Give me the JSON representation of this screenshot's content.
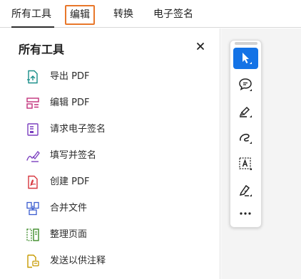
{
  "tabs": [
    {
      "label": "所有工具"
    },
    {
      "label": "编辑"
    },
    {
      "label": "转换"
    },
    {
      "label": "电子签名"
    }
  ],
  "panel": {
    "title": "所有工具",
    "close_icon": "close-icon",
    "tools": [
      {
        "label": "导出 PDF",
        "icon": "export-pdf-icon",
        "color": "#1a8f8a"
      },
      {
        "label": "编辑 PDF",
        "icon": "edit-pdf-icon",
        "color": "#c2307a"
      },
      {
        "label": "请求电子签名",
        "icon": "request-esign-icon",
        "color": "#7b3fbf"
      },
      {
        "label": "填写并签名",
        "icon": "fill-sign-icon",
        "color": "#7b3fbf"
      },
      {
        "label": "创建 PDF",
        "icon": "create-pdf-icon",
        "color": "#d7373f"
      },
      {
        "label": "合并文件",
        "icon": "combine-files-icon",
        "color": "#3a5ccf"
      },
      {
        "label": "整理页面",
        "icon": "organize-pages-icon",
        "color": "#3d8b29"
      },
      {
        "label": "发送以供注释",
        "icon": "send-comment-icon",
        "color": "#c79a00"
      }
    ]
  },
  "quick_tools": [
    {
      "icon": "select-cursor-icon",
      "selected": true
    },
    {
      "icon": "add-comment-icon"
    },
    {
      "icon": "highlight-icon"
    },
    {
      "icon": "freehand-draw-icon"
    },
    {
      "icon": "add-text-icon"
    },
    {
      "icon": "sign-icon"
    },
    {
      "icon": "more-icon"
    }
  ],
  "colors": {
    "accent": "#1473e6",
    "active_tab_outline": "#e8772a"
  }
}
